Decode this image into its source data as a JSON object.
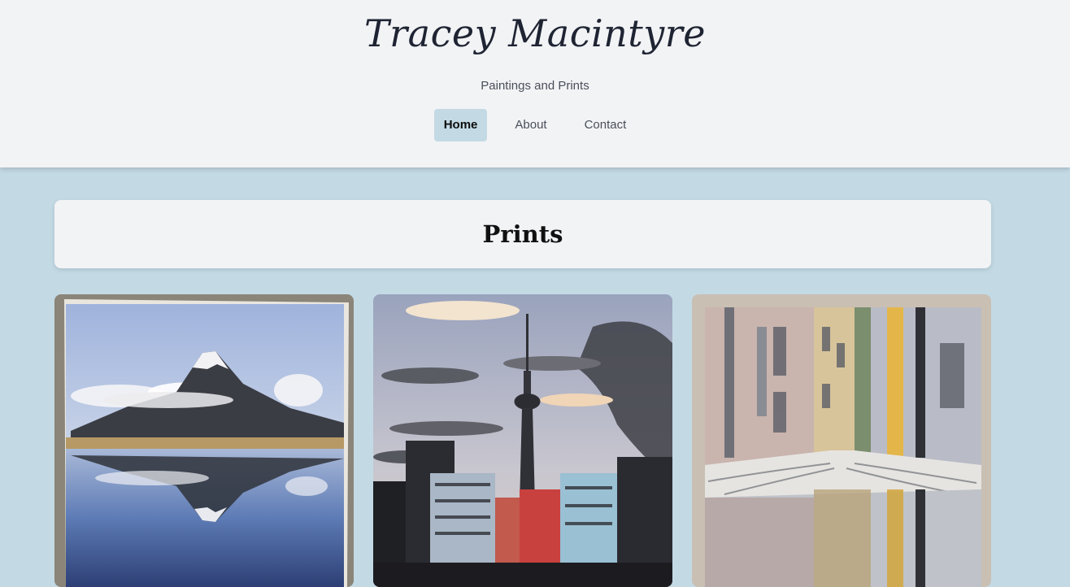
{
  "header": {
    "title": "Tracey Macintyre",
    "tagline": "Paintings and Prints",
    "nav": [
      {
        "label": "Home",
        "active": true
      },
      {
        "label": "About",
        "active": false
      },
      {
        "label": "Contact",
        "active": false
      }
    ]
  },
  "section": {
    "title": "Prints"
  },
  "colors": {
    "page_bg": "#c3dae5",
    "header_bg": "#f2f3f5",
    "active_nav_bg": "#c3dae5",
    "title_text": "#1f2433"
  }
}
